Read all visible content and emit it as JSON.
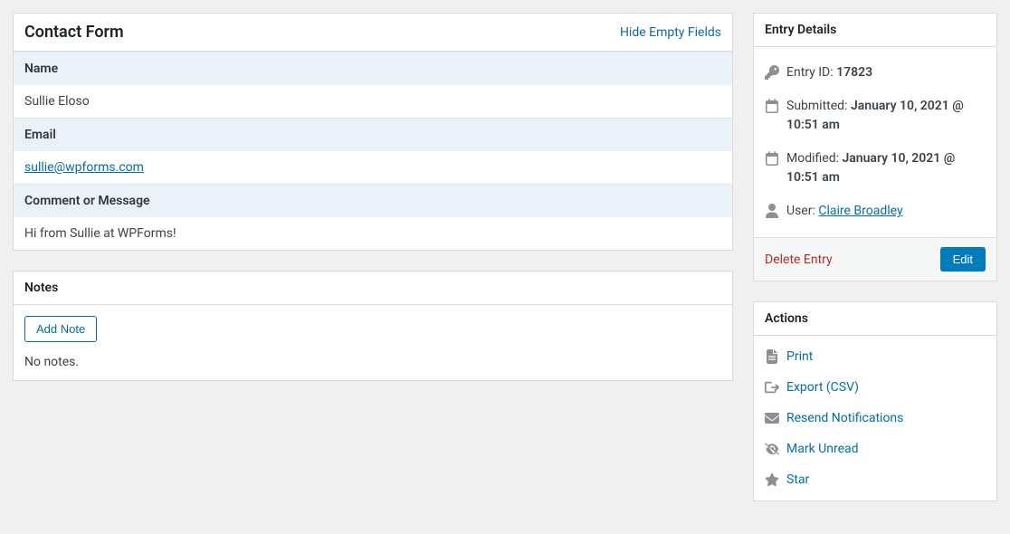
{
  "contactForm": {
    "title": "Contact Form",
    "hideLink": "Hide Empty Fields",
    "fields": {
      "nameLabel": "Name",
      "nameValue": "Sullie Eloso",
      "emailLabel": "Email",
      "emailValue": "sullie@wpforms.com",
      "commentLabel": "Comment or Message",
      "commentValue": "Hi from Sullie at WPForms!"
    }
  },
  "notes": {
    "title": "Notes",
    "addButton": "Add Note",
    "empty": "No notes."
  },
  "entryDetails": {
    "title": "Entry Details",
    "entryIdLabel": "Entry ID:",
    "entryIdValue": "17823",
    "submittedLabel": "Submitted:",
    "submittedValue": "January 10, 2021 @ 10:51 am",
    "modifiedLabel": "Modified:",
    "modifiedValue": "January 10, 2021 @ 10:51 am",
    "userLabel": "User:",
    "userValue": "Claire Broadley",
    "deleteLabel": "Delete Entry",
    "editLabel": "Edit"
  },
  "actions": {
    "title": "Actions",
    "print": "Print",
    "export": "Export (CSV)",
    "resend": "Resend Notifications",
    "markUnread": "Mark Unread",
    "star": "Star"
  }
}
